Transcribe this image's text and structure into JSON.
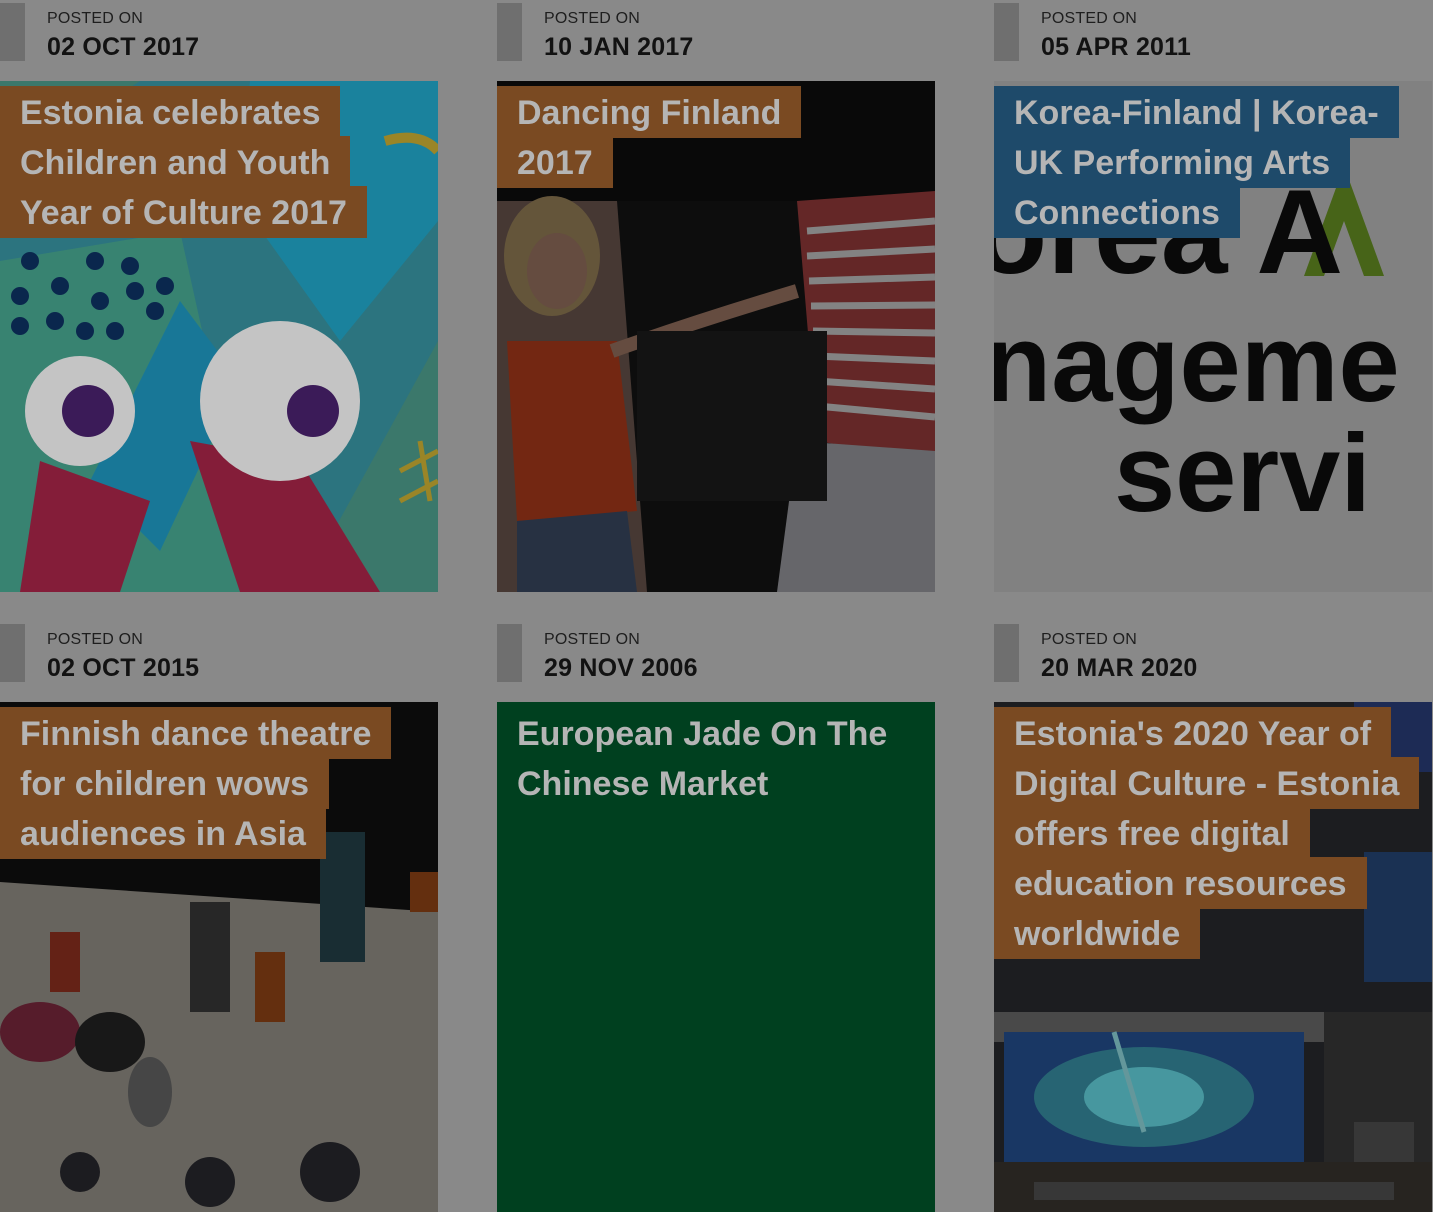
{
  "posted_label": "POSTED ON",
  "posts": [
    {
      "date": "02 OCT 2017",
      "title": "Estonia celebrates Children and Youth Year of Culture 2017",
      "image": "estonia-youth-illustration"
    },
    {
      "date": "10 JAN 2017",
      "title": "Dancing Finland 2017",
      "image": "dancers-photo"
    },
    {
      "date": "05 APR 2011",
      "title": "Korea-Finland | Korea-UK Performing Arts Connections",
      "image": "korea-arts-logo"
    },
    {
      "date": "02 OCT 2015",
      "title": "Finnish dance theatre for children wows audiences in Asia",
      "image": "children-dance-photo"
    },
    {
      "date": "29 NOV 2006",
      "title": "European Jade On The Chinese Market",
      "image": "solid-green"
    },
    {
      "date": "20 MAR 2020",
      "title": "Estonia's 2020 Year of Digital Culture - Estonia offers free digital education resources worldwide",
      "image": "tv-screens-photo"
    }
  ],
  "logo_text": {
    "line1": "orea A",
    "line2": "nageme",
    "line3": "servi"
  },
  "colors": {
    "overlay": "#898989",
    "tag_brown": "#7a4a22",
    "tag_blue": "#1e4a6a",
    "green_tile": "#00401f"
  }
}
